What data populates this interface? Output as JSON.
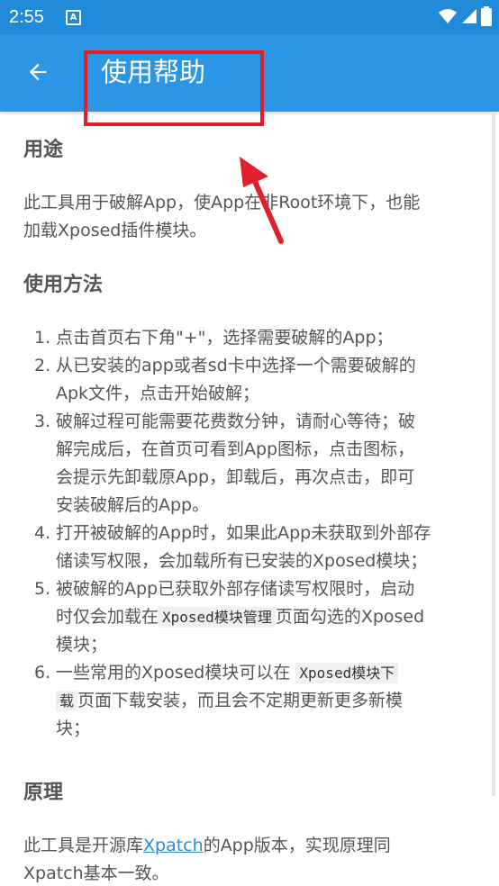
{
  "status_bar": {
    "time": "2:55",
    "notification_letter": "A"
  },
  "app_bar": {
    "title": "使用帮助"
  },
  "colors": {
    "status_bar": "#1f8ad8",
    "app_bar": "#2b96e6",
    "highlight": "#e0202a",
    "link": "#2a8bd8"
  },
  "sections": {
    "purpose": {
      "title": "用途",
      "text_lines": [
        "此工具用于破解App，使App在非Root环境下，也能",
        "加载Xposed插件模块。"
      ]
    },
    "usage": {
      "title": "使用方法",
      "steps": [
        {
          "num": "1.",
          "lines": [
            "点击首页右下角\"+\"，选择需要破解的App；"
          ]
        },
        {
          "num": "2.",
          "lines": [
            "从已安装的app或者sd卡中选择一个需要破解的",
            "Apk文件，点击开始破解；"
          ]
        },
        {
          "num": "3.",
          "lines": [
            "破解过程可能需要花费数分钟，请耐心等待；破",
            "解完成后，在首页可看到App图标，点击图标，",
            "会提示先卸载原App，卸载后，再次点击，即可",
            "安装破解后的App。"
          ]
        },
        {
          "num": "4.",
          "lines": [
            "打开被破解的App时，如果此App未获取到外部存",
            "储读写权限，会加载所有已安装的Xposed模块；"
          ]
        },
        {
          "num": "5.",
          "line1": "被破解的App已获取外部存储读写权限时，启动",
          "line2_pre": "时仅会加载在",
          "code": "Xposed模块管理",
          "line2_post": "页面勾选的Xposed",
          "line3": "模块；"
        },
        {
          "num": "6.",
          "line1_pre": "一些常用的Xposed模块可以在",
          "code_a": "Xposed模块下",
          "code_b": "载",
          "line2_post": "页面下载安装，而且会不定期更新更多新模",
          "line3": "块；"
        }
      ]
    },
    "principle": {
      "title": "原理",
      "pre": "此工具是开源库",
      "link": "Xpatch",
      "post": "的App版本，实现原理同",
      "line2": "Xpatch基本一致。"
    }
  }
}
